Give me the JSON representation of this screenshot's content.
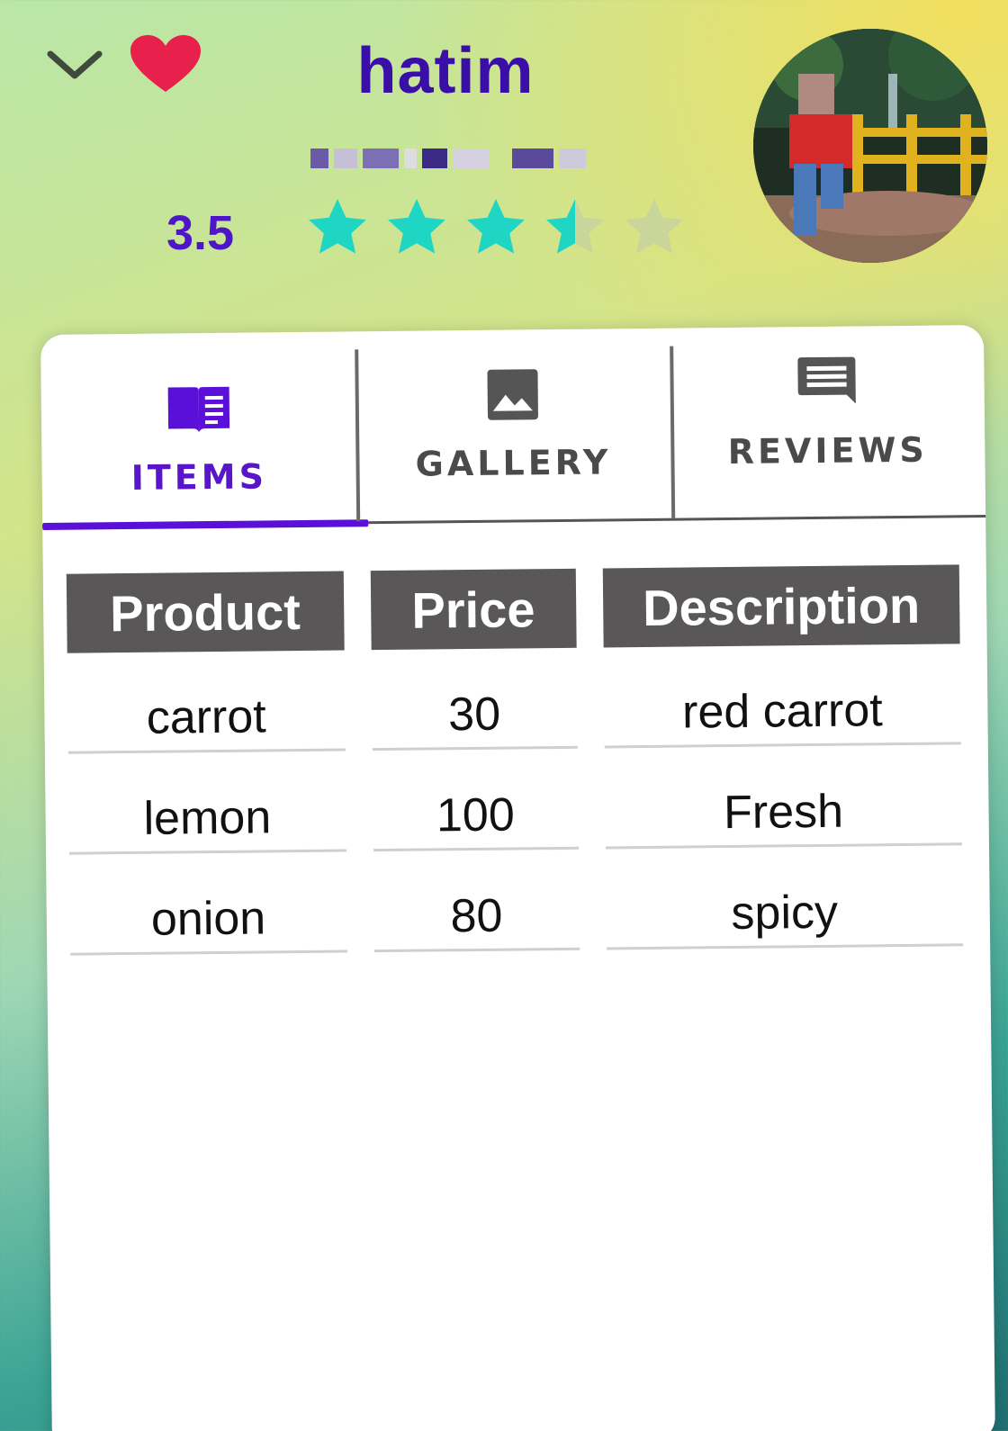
{
  "header": {
    "name": "hatim",
    "rating": "3.5",
    "rating_value": 3.5,
    "rating_max": 5
  },
  "tabs": [
    {
      "label": "ITEMS",
      "icon": "book-icon",
      "active": true
    },
    {
      "label": "GALLERY",
      "icon": "image-icon",
      "active": false
    },
    {
      "label": "REVIEWS",
      "icon": "comment-icon",
      "active": false
    }
  ],
  "table": {
    "headers": [
      "Product",
      "Price",
      "Description"
    ],
    "rows": [
      [
        "carrot",
        "30",
        "red carrot"
      ],
      [
        "lemon",
        "100",
        "Fresh"
      ],
      [
        "onion",
        "80",
        "spicy"
      ]
    ]
  },
  "colors": {
    "accent": "#5b10d9",
    "name": "#3a0fa8",
    "star_filled": "#1fd6c4",
    "star_empty": "#c9d59a",
    "heart": "#e8204c",
    "header_cell": "#5a5758"
  }
}
